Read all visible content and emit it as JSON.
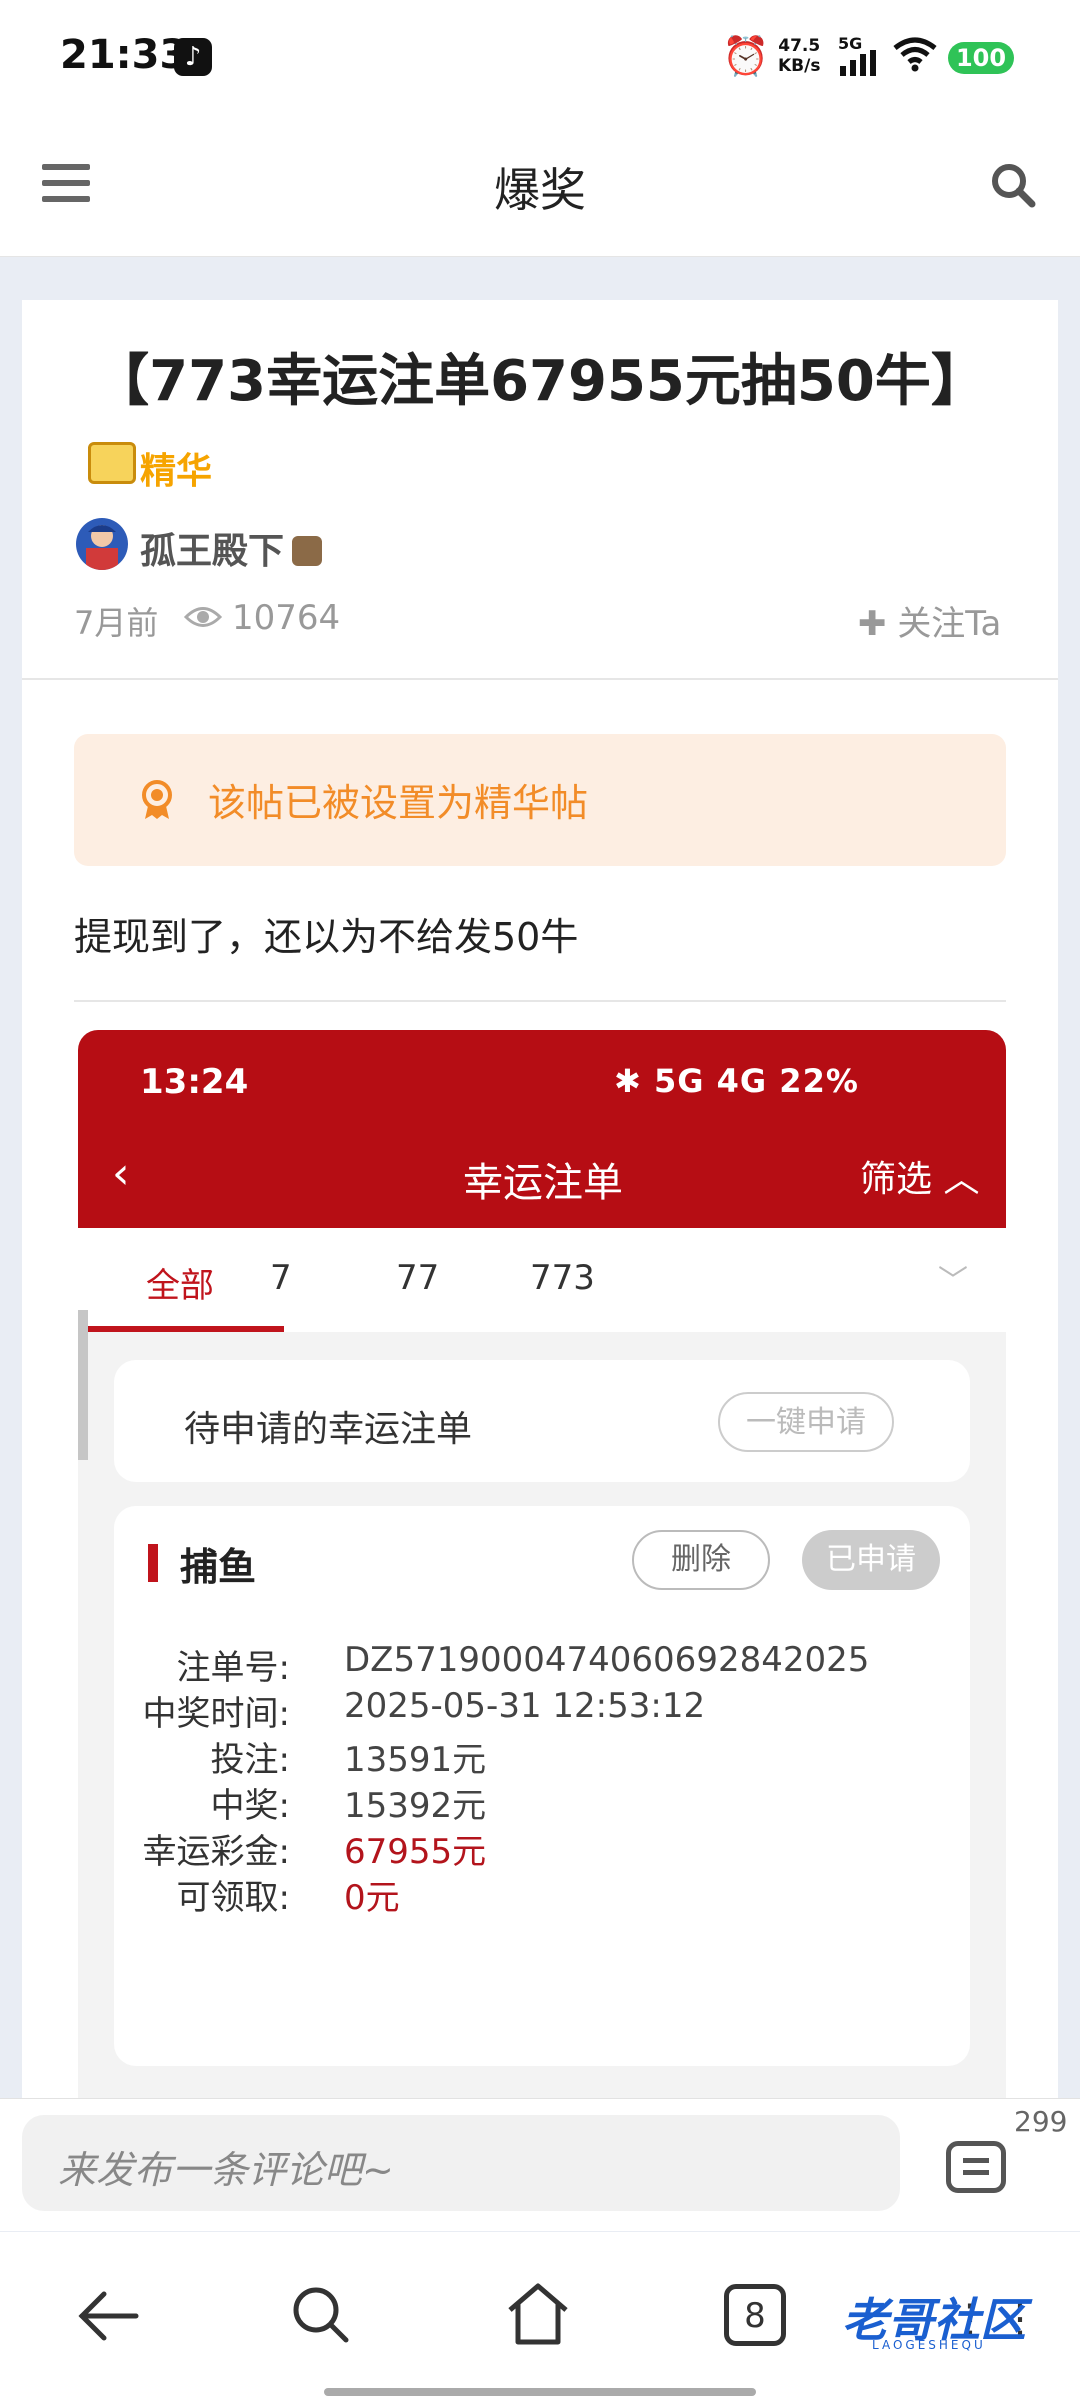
{
  "status_bar": {
    "time": "21:33",
    "net_speed_value": "47.5",
    "net_speed_unit": "KB/s",
    "network": "5G",
    "battery": "100"
  },
  "header": {
    "title": "爆奖"
  },
  "post": {
    "title": "【773幸运注单67955元抽50牛】",
    "badge_label": "精华",
    "author": "孤王殿下",
    "time": "7月前",
    "views": "10764",
    "follow_label": "关注Ta",
    "notice": "该帖已被设置为精华帖",
    "body": "提现到了，还以为不给发50牛"
  },
  "screenshot": {
    "time": "13:24",
    "status_right": "✱ 5G 4G 22%",
    "title": "幸运注单",
    "filter": "筛选",
    "tabs": [
      "全部",
      "7",
      "77",
      "773"
    ],
    "pending_label": "待申请的幸运注单",
    "apply_all": "一键申请",
    "card_title": "捕鱼",
    "delete": "删除",
    "applied": "已申请",
    "rows": [
      {
        "label": "注单号:",
        "value": "DZ5719000474060692842025"
      },
      {
        "label": "中奖时间:",
        "value": "2025-05-31 12:53:12"
      },
      {
        "label": "投注:",
        "value": "13591元"
      },
      {
        "label": "中奖:",
        "value": "15392元"
      },
      {
        "label": "幸运彩金:",
        "value": "67955元"
      },
      {
        "label": "可领取:",
        "value": "0元"
      }
    ]
  },
  "comment_bar": {
    "placeholder": "来发布一条评论吧~",
    "count": "299"
  },
  "nav": {
    "tabs_count": "8",
    "logo": "老哥社区",
    "logo_sub": "LAOGESHEQU"
  },
  "colors": {
    "accent_red": "#b60d14",
    "notice_bg": "#fdeee2",
    "notice_text": "#f28c28",
    "battery_green": "#2fc357"
  }
}
